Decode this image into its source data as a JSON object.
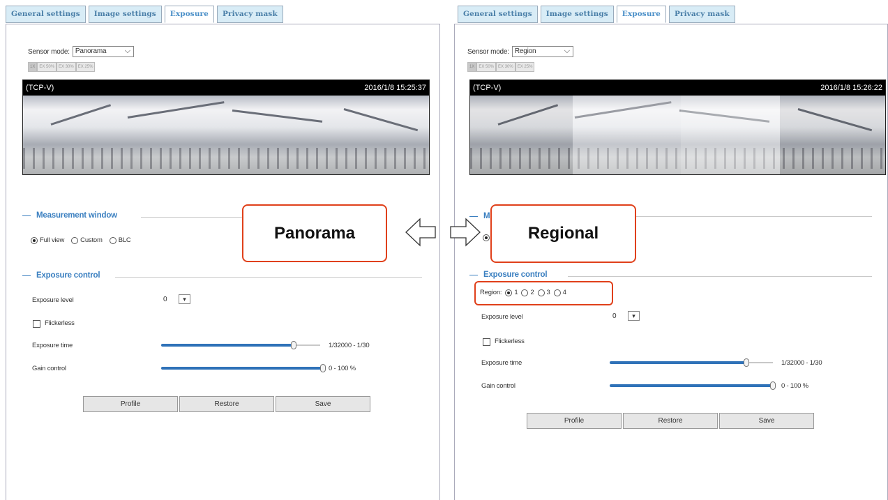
{
  "tabs": [
    "General settings",
    "Image settings",
    "Exposure",
    "Privacy mask"
  ],
  "left": {
    "sensor_label": "Sensor mode:",
    "sensor_value": "Panorama",
    "video_left": "(TCP-V)",
    "video_right": "2016/1/8 15:25:37",
    "measurement_title": "Measurement window",
    "measurement_options": [
      "Full view",
      "Custom",
      "BLC"
    ],
    "exposure_title": "Exposure control",
    "exposure_level_label": "Exposure level",
    "exposure_level_value": "0",
    "flickerless_label": "Flickerless",
    "exposure_time_label": "Exposure time",
    "exposure_time_value": "1/32000 - 1/30",
    "gain_label": "Gain control",
    "gain_value": "0 - 100 %"
  },
  "right": {
    "sensor_label": "Sensor mode:",
    "sensor_value": "Region",
    "video_left": "(TCP-V)",
    "video_right": "2016/1/8 15:26:22",
    "measurement_title": "M",
    "exposure_title": "Exposure control",
    "region_label": "Region:",
    "region_options": [
      "1",
      "2",
      "3",
      "4"
    ],
    "exposure_level_label": "Exposure level",
    "exposure_level_value": "0",
    "flickerless_label": "Flickerless",
    "exposure_time_label": "Exposure time",
    "exposure_time_value": "1/32000 - 1/30",
    "gain_label": "Gain control",
    "gain_value": "0 - 100 %"
  },
  "ratio_buttons": [
    "1X",
    "EX 50%",
    "EX 30%",
    "EX 25%"
  ],
  "buttons": [
    "Profile",
    "Restore",
    "Save"
  ],
  "callouts": {
    "left": "Panorama",
    "right": "Regional"
  },
  "sliders": {
    "exposure_time_fraction": 0.85,
    "gain_fraction": 1.0
  },
  "colors": {
    "callout_border": "#e0401a",
    "accent": "#3a7fc0"
  }
}
